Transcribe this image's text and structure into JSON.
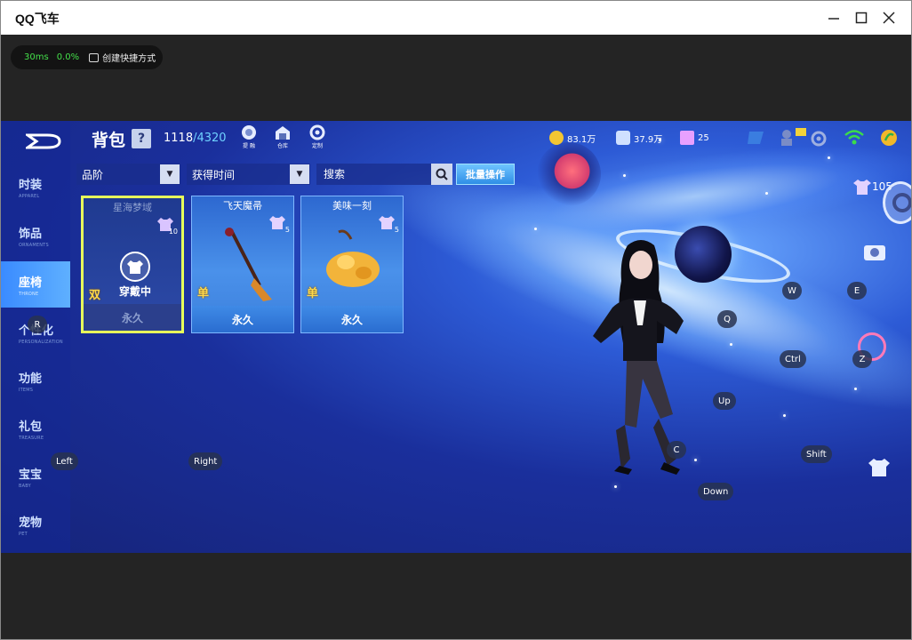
{
  "window": {
    "title": "QQ飞车",
    "minimize": "—",
    "maximize": "☐",
    "close": "✕"
  },
  "perf": {
    "ping": "30ms",
    "loss": "0.0%",
    "shortcut_label": "创建快捷方式"
  },
  "header": {
    "title": "背包",
    "help": "?",
    "capacity_used": "1118",
    "capacity_max": "/4320",
    "icons": [
      {
        "label": "提 融",
        "icon": "fuse-icon"
      },
      {
        "label": "仓库",
        "icon": "warehouse-icon"
      },
      {
        "label": "定制",
        "icon": "customize-icon"
      }
    ]
  },
  "stats": {
    "coins": "83.1万",
    "vouchers": "37.9万",
    "gems": "25"
  },
  "sidebar": {
    "items": [
      {
        "cn": "时装",
        "en": "APPAREL"
      },
      {
        "cn": "饰品",
        "en": "ORNAMENTS"
      },
      {
        "cn": "座椅",
        "en": "THRONE"
      },
      {
        "cn": "个性化",
        "en": "PERSONALIZATION"
      },
      {
        "cn": "功能",
        "en": "ITEMS"
      },
      {
        "cn": "礼包",
        "en": "TREASURE"
      },
      {
        "cn": "宝宝",
        "en": "BABY"
      },
      {
        "cn": "宠物",
        "en": "PET"
      }
    ],
    "active_index": 2
  },
  "filters": {
    "grade": "品阶",
    "time": "获得时间",
    "search_placeholder": "搜索",
    "batch": "批量操作"
  },
  "cards": [
    {
      "name": "星海梦域",
      "tier": "10",
      "stack": "双",
      "duration": "永久",
      "wearing": "穿戴中"
    },
    {
      "name": "飞天魔帚",
      "tier": "5",
      "stack": "单",
      "duration": "永久"
    },
    {
      "name": "美味一刻",
      "tier": "5",
      "stack": "单",
      "duration": "永久"
    }
  ],
  "outfit_badge": "105",
  "keys": {
    "R": "R",
    "Left": "Left",
    "Right": "Right",
    "W": "W",
    "E": "E",
    "Q": "Q",
    "Ctrl": "Ctrl",
    "Z": "Z",
    "Up": "Up",
    "C": "C",
    "Shift": "Shift",
    "Down": "Down"
  },
  "colors": {
    "accent": "#3a8bff",
    "selected_border": "#e7ff5b",
    "ping": "#44e04a"
  }
}
